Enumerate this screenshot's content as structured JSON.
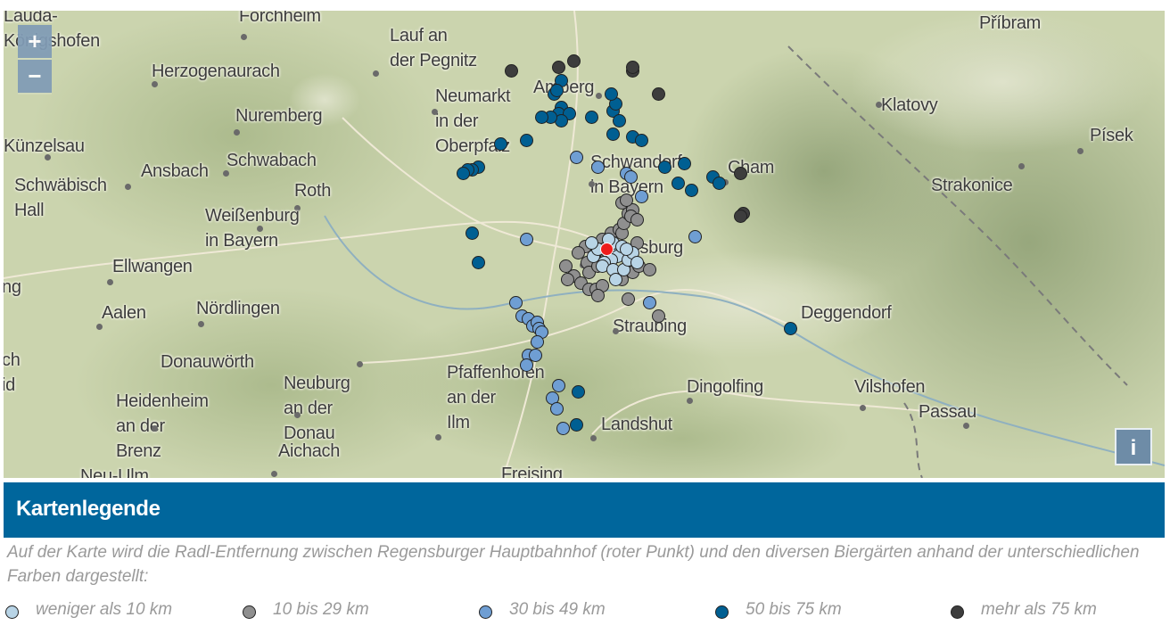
{
  "map": {
    "zoom_in_label": "+",
    "zoom_out_label": "−",
    "info_label": "i",
    "cities": [
      {
        "name": "Lauda-\nKönigshofen"
      },
      {
        "name": "Forchheim"
      },
      {
        "name": "Lauf an\nder Pegnitz"
      },
      {
        "name": "Amberg"
      },
      {
        "name": "Příbram"
      },
      {
        "name": "Herzogenaurach"
      },
      {
        "name": "Neumarkt\nin der\nOberpfalz"
      },
      {
        "name": "Nuremberg"
      },
      {
        "name": "Klatovy"
      },
      {
        "name": "Písek"
      },
      {
        "name": "Künzelsau"
      },
      {
        "name": "Schwabach"
      },
      {
        "name": "Ansbach"
      },
      {
        "name": "Schwandorf\nin Bayern"
      },
      {
        "name": "Cham"
      },
      {
        "name": "Schwäbisch\nHall"
      },
      {
        "name": "Roth"
      },
      {
        "name": "Strakonice"
      },
      {
        "name": "Weißenburg\nin Bayern"
      },
      {
        "name": "Regensburg"
      },
      {
        "name": "Ellwangen"
      },
      {
        "name": "Aalen"
      },
      {
        "name": "Nördlingen"
      },
      {
        "name": "Deggendorf"
      },
      {
        "name": "Straubing"
      },
      {
        "name": "Donauwörth"
      },
      {
        "name": "Heidenheim\nan der\nBrenz"
      },
      {
        "name": "Neuburg\nan der\nDonau"
      },
      {
        "name": "Aichach"
      },
      {
        "name": "Pfaffenhofen\nan der\nIlm"
      },
      {
        "name": "Dingolfing"
      },
      {
        "name": "Vilshofen"
      },
      {
        "name": "Passau"
      },
      {
        "name": "Landshut"
      },
      {
        "name": "Freising"
      },
      {
        "name": "Neu-Ulm"
      },
      {
        "name": "ng"
      },
      {
        "name": "ch\nid"
      }
    ]
  },
  "legend": {
    "title": "Kartenlegende",
    "description": "Auf der Karte wird die Radl-Entfernung zwischen Regensburger Hauptbahnhof (roter Punkt) und den diversen Biergärten anhand der unterschiedlichen Farben dargestellt:",
    "items": [
      {
        "label": "weniger als 10 km",
        "color": "#b8d4e6"
      },
      {
        "label": "10 bis 29 km",
        "color": "#8f8f8f"
      },
      {
        "label": "30 bis 49 km",
        "color": "#6f9ed3"
      },
      {
        "label": "50 bis 75 km",
        "color": "#005f92"
      },
      {
        "label": "mehr als 75 km",
        "color": "#3d3d3d"
      }
    ]
  },
  "beer_gardens": [
    {
      "lat": 49.55,
      "lon": 11.66,
      "cat": 4
    },
    {
      "lat": 49.56,
      "lon": 11.88,
      "cat": 4
    },
    {
      "lat": 49.58,
      "lon": 11.95,
      "cat": 4
    },
    {
      "lat": 49.55,
      "lon": 12.22,
      "cat": 4
    },
    {
      "lat": 49.56,
      "lon": 12.22,
      "cat": 4
    },
    {
      "lat": 49.48,
      "lon": 12.34,
      "cat": 4
    },
    {
      "lat": 49.24,
      "lon": 12.72,
      "cat": 4
    },
    {
      "lat": 49.12,
      "lon": 12.73,
      "cat": 4
    },
    {
      "lat": 49.11,
      "lon": 12.72,
      "cat": 4
    },
    {
      "lat": 49.52,
      "lon": 11.89,
      "cat": 3
    },
    {
      "lat": 49.48,
      "lon": 11.86,
      "cat": 3
    },
    {
      "lat": 49.49,
      "lon": 11.87,
      "cat": 3
    },
    {
      "lat": 49.44,
      "lon": 11.89,
      "cat": 3
    },
    {
      "lat": 49.42,
      "lon": 11.88,
      "cat": 3
    },
    {
      "lat": 49.42,
      "lon": 11.93,
      "cat": 3
    },
    {
      "lat": 49.4,
      "lon": 11.89,
      "cat": 3
    },
    {
      "lat": 49.41,
      "lon": 11.84,
      "cat": 3
    },
    {
      "lat": 49.41,
      "lon": 11.8,
      "cat": 3
    },
    {
      "lat": 49.34,
      "lon": 11.73,
      "cat": 3
    },
    {
      "lat": 49.41,
      "lon": 12.03,
      "cat": 3
    },
    {
      "lat": 49.43,
      "lon": 12.13,
      "cat": 3
    },
    {
      "lat": 49.45,
      "lon": 12.14,
      "cat": 3
    },
    {
      "lat": 49.48,
      "lon": 12.12,
      "cat": 3
    },
    {
      "lat": 49.4,
      "lon": 12.16,
      "cat": 3
    },
    {
      "lat": 49.36,
      "lon": 12.13,
      "cat": 3
    },
    {
      "lat": 49.35,
      "lon": 12.22,
      "cat": 3
    },
    {
      "lat": 49.34,
      "lon": 12.26,
      "cat": 3
    },
    {
      "lat": 49.26,
      "lon": 12.37,
      "cat": 3
    },
    {
      "lat": 49.27,
      "lon": 12.46,
      "cat": 3
    },
    {
      "lat": 49.21,
      "lon": 12.43,
      "cat": 3
    },
    {
      "lat": 49.19,
      "lon": 12.49,
      "cat": 3
    },
    {
      "lat": 49.23,
      "lon": 12.59,
      "cat": 3
    },
    {
      "lat": 49.21,
      "lon": 12.62,
      "cat": 3
    },
    {
      "lat": 49.26,
      "lon": 11.51,
      "cat": 3
    },
    {
      "lat": 49.25,
      "lon": 11.48,
      "cat": 3
    },
    {
      "lat": 49.25,
      "lon": 11.46,
      "cat": 3
    },
    {
      "lat": 49.24,
      "lon": 11.44,
      "cat": 3
    },
    {
      "lat": 49.06,
      "lon": 11.48,
      "cat": 3
    },
    {
      "lat": 48.97,
      "lon": 11.51,
      "cat": 3
    },
    {
      "lat": 48.58,
      "lon": 11.97,
      "cat": 3
    },
    {
      "lat": 48.48,
      "lon": 11.96,
      "cat": 3
    },
    {
      "lat": 48.77,
      "lon": 12.95,
      "cat": 3
    },
    {
      "lat": 49.33,
      "lon": 11.61,
      "cat": 3
    },
    {
      "lat": 49.29,
      "lon": 11.96,
      "cat": 2
    },
    {
      "lat": 49.26,
      "lon": 12.06,
      "cat": 2
    },
    {
      "lat": 49.24,
      "lon": 12.19,
      "cat": 2
    },
    {
      "lat": 49.23,
      "lon": 12.21,
      "cat": 2
    },
    {
      "lat": 49.04,
      "lon": 11.73,
      "cat": 2
    },
    {
      "lat": 48.85,
      "lon": 11.68,
      "cat": 2
    },
    {
      "lat": 48.81,
      "lon": 11.71,
      "cat": 2
    },
    {
      "lat": 48.8,
      "lon": 11.74,
      "cat": 2
    },
    {
      "lat": 48.78,
      "lon": 11.76,
      "cat": 2
    },
    {
      "lat": 48.79,
      "lon": 11.78,
      "cat": 2
    },
    {
      "lat": 48.77,
      "lon": 11.79,
      "cat": 2
    },
    {
      "lat": 48.76,
      "lon": 11.8,
      "cat": 2
    },
    {
      "lat": 48.73,
      "lon": 11.78,
      "cat": 2
    },
    {
      "lat": 48.69,
      "lon": 11.74,
      "cat": 2
    },
    {
      "lat": 48.66,
      "lon": 11.73,
      "cat": 2
    },
    {
      "lat": 48.69,
      "lon": 11.77,
      "cat": 2
    },
    {
      "lat": 48.6,
      "lon": 11.88,
      "cat": 2
    },
    {
      "lat": 48.56,
      "lon": 11.85,
      "cat": 2
    },
    {
      "lat": 48.53,
      "lon": 11.87,
      "cat": 2
    },
    {
      "lat": 48.47,
      "lon": 11.9,
      "cat": 2
    },
    {
      "lat": 48.85,
      "lon": 12.3,
      "cat": 2
    },
    {
      "lat": 49.17,
      "lon": 12.26,
      "cat": 2
    },
    {
      "lat": 49.05,
      "lon": 12.51,
      "cat": 2
    },
    {
      "lat": 49.04,
      "lon": 12.08,
      "cat": 1
    },
    {
      "lat": 49.06,
      "lon": 12.12,
      "cat": 1
    },
    {
      "lat": 49.02,
      "lon": 12.15,
      "cat": 1
    },
    {
      "lat": 49.07,
      "lon": 12.16,
      "cat": 1
    },
    {
      "lat": 49.06,
      "lon": 12.17,
      "cat": 1
    },
    {
      "lat": 49.09,
      "lon": 12.18,
      "cat": 1
    },
    {
      "lat": 49.12,
      "lon": 12.2,
      "cat": 1
    },
    {
      "lat": 49.13,
      "lon": 12.22,
      "cat": 1
    },
    {
      "lat": 49.11,
      "lon": 12.21,
      "cat": 1
    },
    {
      "lat": 49.15,
      "lon": 12.17,
      "cat": 1
    },
    {
      "lat": 49.16,
      "lon": 12.19,
      "cat": 1
    },
    {
      "lat": 49.1,
      "lon": 12.24,
      "cat": 1
    },
    {
      "lat": 49.03,
      "lon": 12.24,
      "cat": 1
    },
    {
      "lat": 49.02,
      "lon": 12.0,
      "cat": 1
    },
    {
      "lat": 48.98,
      "lon": 12.04,
      "cat": 1
    },
    {
      "lat": 48.97,
      "lon": 12.01,
      "cat": 1
    },
    {
      "lat": 48.93,
      "lon": 11.95,
      "cat": 1
    },
    {
      "lat": 48.96,
      "lon": 11.91,
      "cat": 1
    },
    {
      "lat": 48.92,
      "lon": 11.92,
      "cat": 1
    },
    {
      "lat": 48.91,
      "lon": 11.98,
      "cat": 1
    },
    {
      "lat": 48.94,
      "lon": 12.02,
      "cat": 1
    },
    {
      "lat": 48.96,
      "lon": 12.06,
      "cat": 1
    },
    {
      "lat": 48.99,
      "lon": 12.1,
      "cat": 1
    },
    {
      "lat": 48.92,
      "lon": 12.17,
      "cat": 1
    },
    {
      "lat": 48.94,
      "lon": 12.22,
      "cat": 1
    },
    {
      "lat": 48.96,
      "lon": 12.25,
      "cat": 1
    },
    {
      "lat": 48.95,
      "lon": 12.3,
      "cat": 1
    },
    {
      "lat": 48.89,
      "lon": 12.02,
      "cat": 1
    },
    {
      "lat": 48.89,
      "lon": 12.05,
      "cat": 1
    },
    {
      "lat": 48.9,
      "lon": 12.08,
      "cat": 1
    },
    {
      "lat": 48.87,
      "lon": 12.06,
      "cat": 1
    },
    {
      "lat": 48.86,
      "lon": 12.2,
      "cat": 1
    },
    {
      "lat": 48.81,
      "lon": 12.34,
      "cat": 1
    },
    {
      "lat": 49.0,
      "lon": 11.97,
      "cat": 1
    },
    {
      "lat": 49.01,
      "lon": 12.09,
      "cat": 0
    },
    {
      "lat": 49.0,
      "lon": 12.11,
      "cat": 0
    },
    {
      "lat": 49.02,
      "lon": 12.12,
      "cat": 0
    },
    {
      "lat": 49.03,
      "lon": 12.13,
      "cat": 0
    },
    {
      "lat": 48.99,
      "lon": 12.15,
      "cat": 0
    },
    {
      "lat": 48.98,
      "lon": 12.12,
      "cat": 0
    },
    {
      "lat": 48.97,
      "lon": 12.09,
      "cat": 0
    },
    {
      "lat": 48.96,
      "lon": 12.08,
      "cat": 0
    },
    {
      "lat": 48.99,
      "lon": 12.04,
      "cat": 0
    },
    {
      "lat": 49.01,
      "lon": 12.06,
      "cat": 0
    },
    {
      "lat": 49.03,
      "lon": 12.03,
      "cat": 0
    },
    {
      "lat": 48.95,
      "lon": 12.13,
      "cat": 0
    },
    {
      "lat": 48.95,
      "lon": 12.18,
      "cat": 0
    },
    {
      "lat": 48.98,
      "lon": 12.2,
      "cat": 0
    },
    {
      "lat": 49.0,
      "lon": 12.22,
      "cat": 0
    },
    {
      "lat": 48.97,
      "lon": 12.24,
      "cat": 0
    },
    {
      "lat": 48.92,
      "lon": 12.14,
      "cat": 0
    },
    {
      "lat": 49.02,
      "lon": 12.17,
      "cat": 0
    },
    {
      "lat": 49.01,
      "lon": 12.19,
      "cat": 0
    },
    {
      "lat": 49.04,
      "lon": 12.11,
      "cat": 0
    }
  ],
  "station": {
    "lat": 49.01,
    "lon": 12.1,
    "color": "#ee1c1c"
  }
}
